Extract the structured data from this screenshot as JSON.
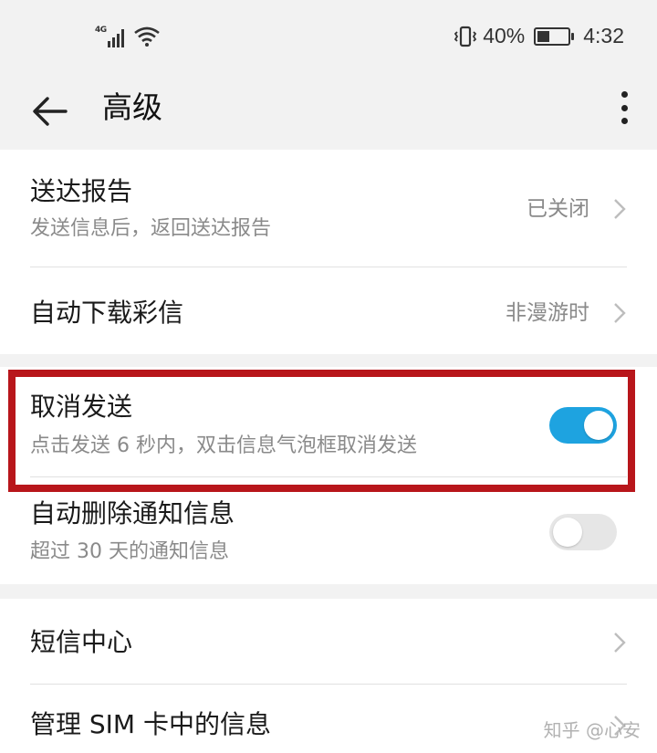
{
  "status_bar": {
    "network_type": "4G",
    "battery_percent": "40%",
    "battery_level": 0.4,
    "time": "4:32",
    "icons": [
      "signal-icon",
      "wifi-icon",
      "vibrate-icon",
      "battery-icon"
    ]
  },
  "app_bar": {
    "title": "高级",
    "back_icon": "back-arrow-icon",
    "more_icon": "more-vert-icon"
  },
  "sections": {
    "delivery_report": {
      "label": "送达报告",
      "subtitle": "发送信息后，返回送达报告",
      "value": "已关闭"
    },
    "auto_download_mms": {
      "label": "自动下载彩信",
      "value": "非漫游时"
    },
    "cancel_send": {
      "label": "取消发送",
      "subtitle": "点击发送 6 秒内，双击信息气泡框取消发送",
      "enabled": true
    },
    "auto_delete_notifications": {
      "label": "自动删除通知信息",
      "subtitle": "超过 30 天的通知信息",
      "enabled": false
    },
    "sms_center": {
      "label": "短信中心"
    },
    "manage_sim_messages": {
      "label": "管理 SIM 卡中的信息"
    }
  },
  "colors": {
    "toggle_on": "#1ea3e0",
    "toggle_off": "#e6e6e6",
    "highlight_box": "#b8161b"
  },
  "watermark": "知乎 @心安"
}
